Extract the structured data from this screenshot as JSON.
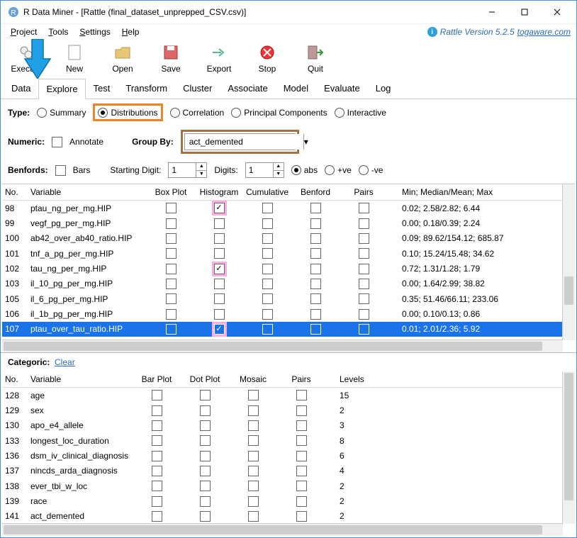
{
  "window": {
    "title": "R Data Miner - [Rattle (final_dataset_unprepped_CSV.csv)]"
  },
  "menus": {
    "project": "Project",
    "tools": "Tools",
    "settings": "Settings",
    "help": "Help"
  },
  "version": {
    "prefix": "Rattle Version 5.2.5 ",
    "link": "togaware.com"
  },
  "toolbar": {
    "execute": "Execute",
    "new": "New",
    "open": "Open",
    "save": "Save",
    "export": "Export",
    "stop": "Stop",
    "quit": "Quit"
  },
  "tabs": {
    "data": "Data",
    "explore": "Explore",
    "test": "Test",
    "transform": "Transform",
    "cluster": "Cluster",
    "associate": "Associate",
    "model": "Model",
    "evaluate": "Evaluate",
    "log": "Log"
  },
  "type_row": {
    "label": "Type:",
    "summary": "Summary",
    "distributions": "Distributions",
    "correlation": "Correlation",
    "principal": "Principal Components",
    "interactive": "Interactive"
  },
  "numeric_row": {
    "label": "Numeric:",
    "annotate": "Annotate",
    "groupby": "Group By:",
    "groupby_val": "act_demented"
  },
  "benfords_row": {
    "label": "Benfords:",
    "bars": "Bars",
    "starting": "Starting Digit:",
    "start_val": "1",
    "digits": "Digits:",
    "digits_val": "1",
    "abs": "abs",
    "pve": "+ve",
    "mve": "-ve"
  },
  "num_table": {
    "cols": {
      "no": "No.",
      "var": "Variable",
      "box": "Box Plot",
      "hist": "Histogram",
      "cum": "Cumulative",
      "ben": "Benford",
      "pairs": "Pairs",
      "stats": "Min; Median/Mean; Max"
    },
    "rows": [
      {
        "no": "98",
        "var": "ptau_ng_per_mg.HIP",
        "hist": true,
        "stats": "0.02; 2.58/2.82; 6.44",
        "pink": true
      },
      {
        "no": "99",
        "var": "vegf_pg_per_mg.HIP",
        "stats": "0.00; 0.18/0.39; 2.24"
      },
      {
        "no": "100",
        "var": "ab42_over_ab40_ratio.HIP",
        "stats": "0.09; 89.62/154.12; 685.87"
      },
      {
        "no": "101",
        "var": "tnf_a_pg_per_mg.HIP",
        "stats": "0.10; 15.24/15.48; 34.62"
      },
      {
        "no": "102",
        "var": "tau_ng_per_mg.HIP",
        "hist": true,
        "stats": "0.72; 1.31/1.28; 1.79",
        "pink": true
      },
      {
        "no": "103",
        "var": "il_10_pg_per_mg.HIP",
        "stats": "0.00; 1.64/2.99; 38.82"
      },
      {
        "no": "105",
        "var": "il_6_pg_per_mg.HIP",
        "stats": "0.35; 51.46/66.11; 233.06"
      },
      {
        "no": "106",
        "var": "il_1b_pg_per_mg.HIP",
        "stats": "0.00; 0.10/0.13; 0.86"
      },
      {
        "no": "107",
        "var": "ptau_over_tau_ratio.HIP",
        "hist": true,
        "stats": "0.01; 2.01/2.36; 5.92",
        "sel": true,
        "pink": true
      }
    ]
  },
  "categoric": {
    "label": "Categoric:",
    "clear": "Clear"
  },
  "cat_table": {
    "cols": {
      "no": "No.",
      "var": "Variable",
      "bar": "Bar Plot",
      "dot": "Dot Plot",
      "mosaic": "Mosaic",
      "pairs": "Pairs",
      "levels": "Levels"
    },
    "rows": [
      {
        "no": "128",
        "var": "age",
        "levels": "15"
      },
      {
        "no": "129",
        "var": "sex",
        "levels": "2"
      },
      {
        "no": "130",
        "var": "apo_e4_allele",
        "levels": "3"
      },
      {
        "no": "133",
        "var": "longest_loc_duration",
        "levels": "8"
      },
      {
        "no": "136",
        "var": "dsm_iv_clinical_diagnosis",
        "levels": "6"
      },
      {
        "no": "137",
        "var": "nincds_arda_diagnosis",
        "levels": "4"
      },
      {
        "no": "138",
        "var": "ever_tbi_w_loc",
        "levels": "2"
      },
      {
        "no": "139",
        "var": "race",
        "levels": "2"
      },
      {
        "no": "141",
        "var": "act_demented",
        "levels": "2"
      }
    ]
  }
}
